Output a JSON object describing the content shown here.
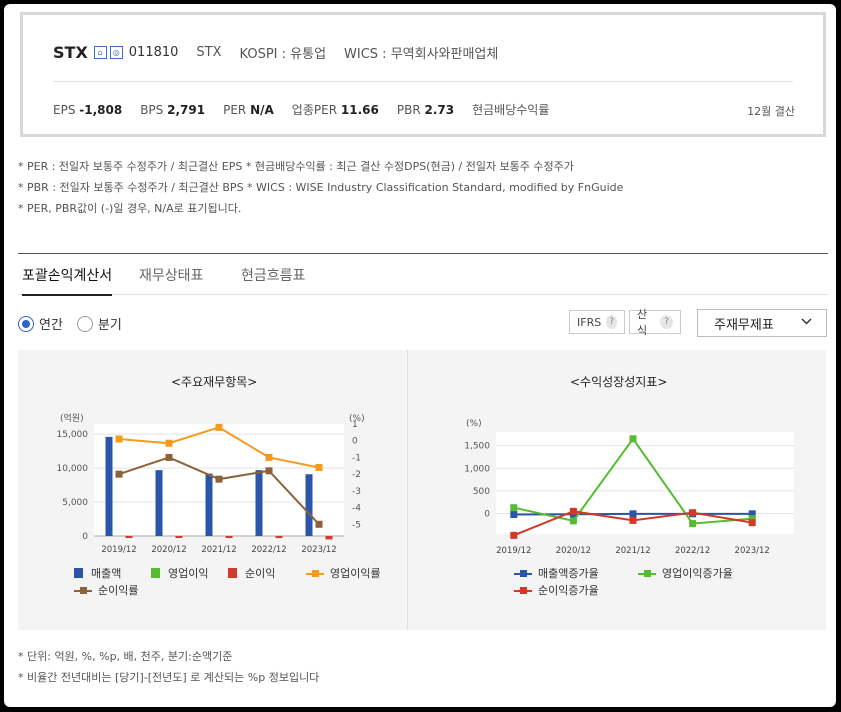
{
  "summary": {
    "ticker": "STX",
    "icon1": "⌂",
    "icon2": "◎",
    "code": "011810",
    "eng": "STX",
    "market": "KOSPI : 유통업",
    "wics": "WICS : 무역회사와판매업체",
    "eps_label": "EPS",
    "eps": "-1,808",
    "bps_label": "BPS",
    "bps": "2,791",
    "per_label": "PER",
    "per": "N/A",
    "sector_per_label": "업종PER",
    "sector_per": "11.66",
    "pbr_label": "PBR",
    "pbr": "2.73",
    "dividend_label": "현금배당수익률",
    "settlement": "12월 결산"
  },
  "notes": [
    "* PER : 전일자 보통주 수정주가 / 최근결산 EPS * 현금배당수익률 : 최근 결산 수정DPS(현금) / 전일자 보통주 수정주가",
    "* PBR : 전일자 보통주 수정주가 / 최근결산 BPS * WICS : WISE Industry Classification Standard, modified by FnGuide",
    "* PER, PBR값이 (-)일 경우, N/A로 표기됩니다."
  ],
  "tabs": [
    "포괄손익계산서",
    "재무상태표",
    "현금흐름표"
  ],
  "period": {
    "annual": "연간",
    "quarter": "분기"
  },
  "ifrs_label": "IFRS",
  "calc_label": "산식",
  "help_glyph": "?",
  "dropdown_value": "주재무제표",
  "dropdown_icon": "chevron-down-icon",
  "colors": {
    "sales": "#2b55a8",
    "op_income": "#55bb33",
    "net_income": "#d03a2a",
    "op_margin": "#f59a1b",
    "net_margin": "#8c6239"
  },
  "chart_data": [
    {
      "type": "bar",
      "title": "<주요재무항목>",
      "y_left_unit": "(억원)",
      "y_right_unit": "(%)",
      "y_left_ticks": [
        "15,000",
        "10,000",
        "5,000",
        "0"
      ],
      "y_right_ticks": [
        "1",
        "0",
        "-1",
        "-2",
        "-3",
        "-4",
        "-5"
      ],
      "ylim_left": [
        0,
        16500
      ],
      "ylim_right": [
        -5.7,
        1
      ],
      "categories": [
        "2019/12",
        "2020/12",
        "2021/12",
        "2022/12",
        "2023/12"
      ],
      "series": [
        {
          "name": "매출액",
          "kind": "bar",
          "axis": "left",
          "values": [
            14600,
            9700,
            9200,
            9700,
            9100
          ]
        },
        {
          "name": "영업이익",
          "kind": "bar",
          "axis": "left",
          "values": [
            0,
            0,
            0,
            0,
            0
          ]
        },
        {
          "name": "순이익",
          "kind": "bar",
          "axis": "left",
          "values": [
            -50,
            -30,
            -60,
            -40,
            -500
          ]
        },
        {
          "name": "영업이익률",
          "kind": "line",
          "axis": "right",
          "values": [
            0.1,
            -0.15,
            0.8,
            -1.0,
            -1.6
          ]
        },
        {
          "name": "순이익률",
          "kind": "line",
          "axis": "right",
          "values": [
            -2.0,
            -1.0,
            -2.3,
            -1.8,
            -5.0
          ]
        }
      ]
    },
    {
      "type": "line",
      "title": "<수익성장성지표>",
      "y_unit": "(%)",
      "y_ticks": [
        "1,500",
        "1,000",
        "500",
        "0"
      ],
      "ylim": [
        -450,
        1800
      ],
      "categories": [
        "2019/12",
        "2020/12",
        "2021/12",
        "2022/12",
        "2023/12"
      ],
      "series": [
        {
          "name": "매출액증가율",
          "values": [
            -20,
            -15,
            -5,
            -5,
            -5
          ]
        },
        {
          "name": "영업이익증가율",
          "values": [
            130,
            -160,
            1650,
            -220,
            -110
          ]
        },
        {
          "name": "순이익증가율",
          "values": [
            -480,
            50,
            -150,
            20,
            -200
          ]
        }
      ]
    }
  ],
  "footnotes": [
    "* 단위: 억원, %, %p, 배, 천주, 분기:순액기준",
    "* 비율간 전년대비는 [당기]-[전년도] 로 계산되는 %p 정보입니다"
  ]
}
